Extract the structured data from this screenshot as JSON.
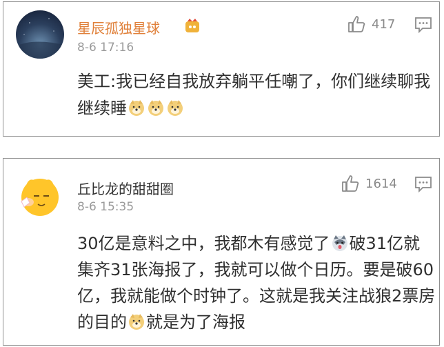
{
  "comments": [
    {
      "username": "星辰孤独星球",
      "time": "8-6 17:16",
      "likes": "417",
      "accent": "#e0803a",
      "text_a": "美工:我已经自我放弃躺平任嘲了，你们继续聊我继续睡",
      "emojis": [
        "doge-emoji",
        "doge-emoji",
        "doge-emoji"
      ]
    },
    {
      "username": "丘比龙的甜甜圈",
      "time": "8-6 15:35",
      "likes": "1614",
      "text_a": "30亿是意料之中，我都木有感觉了",
      "text_b": "破31亿就集齐31张海报了，我就可以做个日历。要是破60亿，我就能做个时钟了。这就是我关注战狼2票房的目的",
      "text_c": "就是为了海报",
      "emojis": [
        "husky-emoji",
        "doge-emoji"
      ]
    }
  ],
  "icons": {
    "like": "thumbs-up-icon",
    "reply": "comment-icon",
    "badge": "crown-badge-icon"
  }
}
